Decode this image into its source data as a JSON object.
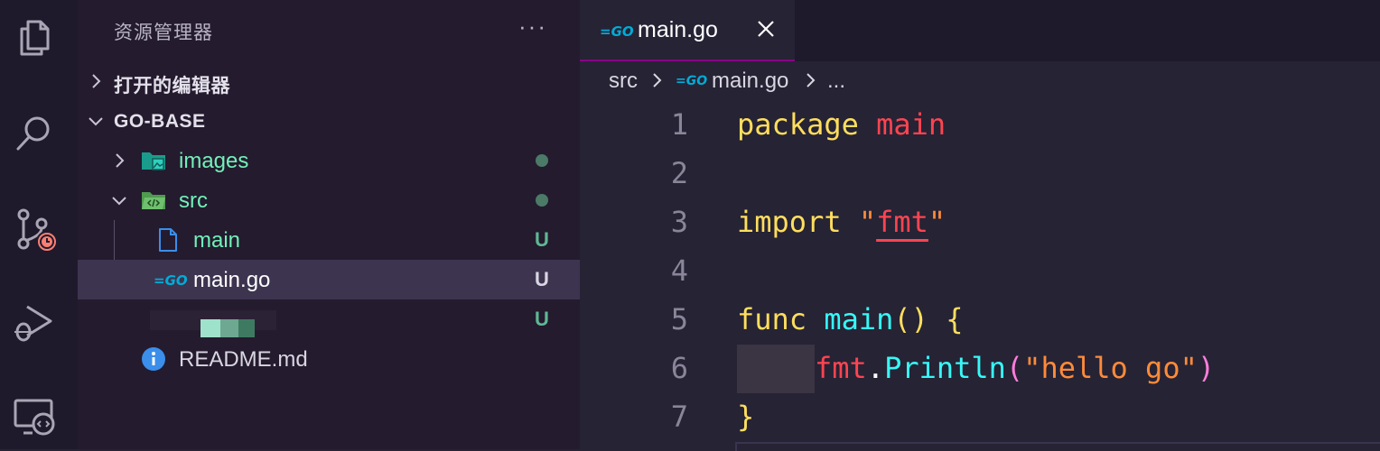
{
  "activity_bar": {
    "icons": [
      "files-icon",
      "search-icon",
      "source-control-icon",
      "run-debug-icon",
      "remote-explorer-icon"
    ]
  },
  "sidebar": {
    "title": "资源管理器",
    "more": "···",
    "sections": {
      "open_editors": "打开的编辑器",
      "project": "GO-BASE"
    },
    "tree": {
      "images": "images",
      "src": "src",
      "main": "main",
      "main_go": "main.go",
      "readme": "README.md"
    },
    "status": {
      "untracked": "U"
    }
  },
  "editor": {
    "tab": {
      "label": "main.go"
    },
    "breadcrumb": {
      "folder": "src",
      "file": "main.go",
      "ellipsis": "..."
    },
    "line_numbers": [
      "1",
      "2",
      "3",
      "4",
      "5",
      "6",
      "7"
    ],
    "code": {
      "l1_kw": "package",
      "l1_name": "main",
      "l3_kw": "import",
      "l3_q1": "\"",
      "l3_str": "fmt",
      "l3_q2": "\"",
      "l5_kw": "func",
      "l5_fn": "main",
      "l5_parens": "()",
      "l5_brace": "{",
      "l6_pkg": "fmt",
      "l6_dot": ".",
      "l6_fn": "Println",
      "l6_open": "(",
      "l6_str": "\"hello go\"",
      "l6_close": ")",
      "l7_brace": "}"
    }
  },
  "colors": {
    "keyword": "#fede5d",
    "name": "#fe4450",
    "string": "#ff8b39",
    "function": "#36f9f6",
    "accent": "#880088"
  }
}
